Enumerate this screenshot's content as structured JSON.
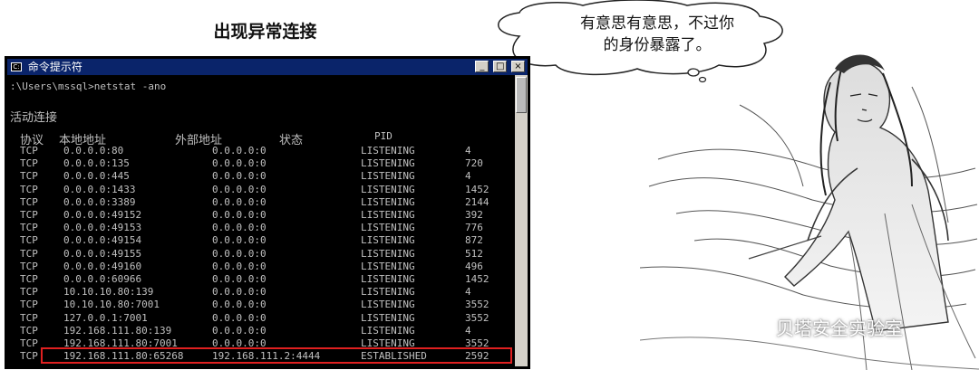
{
  "page_title": "出现异常连接",
  "bubble_text_line1": "有意思有意思，不过你",
  "bubble_text_line2": "的身份暴露了。",
  "watermark": "贝塔安全实验室",
  "window": {
    "title": "命令提示符",
    "min_btn": "_",
    "max_btn": "□",
    "close_btn": "×"
  },
  "terminal": {
    "prompt_line": ":\\Users\\mssql>netstat -ano",
    "section_title": "活动连接",
    "headers": {
      "proto": "协议",
      "local": "本地地址",
      "foreign": "外部地址",
      "state": "状态",
      "pid": "PID"
    },
    "rows": [
      {
        "proto": "TCP",
        "local": "0.0.0.0:80",
        "foreign": "0.0.0.0:0",
        "state": "LISTENING",
        "pid": "4"
      },
      {
        "proto": "TCP",
        "local": "0.0.0.0:135",
        "foreign": "0.0.0.0:0",
        "state": "LISTENING",
        "pid": "720"
      },
      {
        "proto": "TCP",
        "local": "0.0.0.0:445",
        "foreign": "0.0.0.0:0",
        "state": "LISTENING",
        "pid": "4"
      },
      {
        "proto": "TCP",
        "local": "0.0.0.0:1433",
        "foreign": "0.0.0.0:0",
        "state": "LISTENING",
        "pid": "1452"
      },
      {
        "proto": "TCP",
        "local": "0.0.0.0:3389",
        "foreign": "0.0.0.0:0",
        "state": "LISTENING",
        "pid": "2144"
      },
      {
        "proto": "TCP",
        "local": "0.0.0.0:49152",
        "foreign": "0.0.0.0:0",
        "state": "LISTENING",
        "pid": "392"
      },
      {
        "proto": "TCP",
        "local": "0.0.0.0:49153",
        "foreign": "0.0.0.0:0",
        "state": "LISTENING",
        "pid": "776"
      },
      {
        "proto": "TCP",
        "local": "0.0.0.0:49154",
        "foreign": "0.0.0.0:0",
        "state": "LISTENING",
        "pid": "872"
      },
      {
        "proto": "TCP",
        "local": "0.0.0.0:49155",
        "foreign": "0.0.0.0:0",
        "state": "LISTENING",
        "pid": "512"
      },
      {
        "proto": "TCP",
        "local": "0.0.0.0:49160",
        "foreign": "0.0.0.0:0",
        "state": "LISTENING",
        "pid": "496"
      },
      {
        "proto": "TCP",
        "local": "0.0.0.0:60966",
        "foreign": "0.0.0.0:0",
        "state": "LISTENING",
        "pid": "1452"
      },
      {
        "proto": "TCP",
        "local": "10.10.10.80:139",
        "foreign": "0.0.0.0:0",
        "state": "LISTENING",
        "pid": "4"
      },
      {
        "proto": "TCP",
        "local": "10.10.10.80:7001",
        "foreign": "0.0.0.0:0",
        "state": "LISTENING",
        "pid": "3552"
      },
      {
        "proto": "TCP",
        "local": "127.0.0.1:7001",
        "foreign": "0.0.0.0:0",
        "state": "LISTENING",
        "pid": "3552"
      },
      {
        "proto": "TCP",
        "local": "192.168.111.80:139",
        "foreign": "0.0.0.0:0",
        "state": "LISTENING",
        "pid": "4"
      },
      {
        "proto": "TCP",
        "local": "192.168.111.80:7001",
        "foreign": "0.0.0.0:0",
        "state": "LISTENING",
        "pid": "3552"
      },
      {
        "proto": "TCP",
        "local": "192.168.111.80:65268",
        "foreign": "192.168.111.2:4444",
        "state": "ESTABLISHED",
        "pid": "2592"
      }
    ]
  },
  "colors": {
    "titlebar": "#0a246a",
    "terminal_bg": "#000000",
    "terminal_fg": "#c0c0c0",
    "highlight": "#e02020"
  }
}
